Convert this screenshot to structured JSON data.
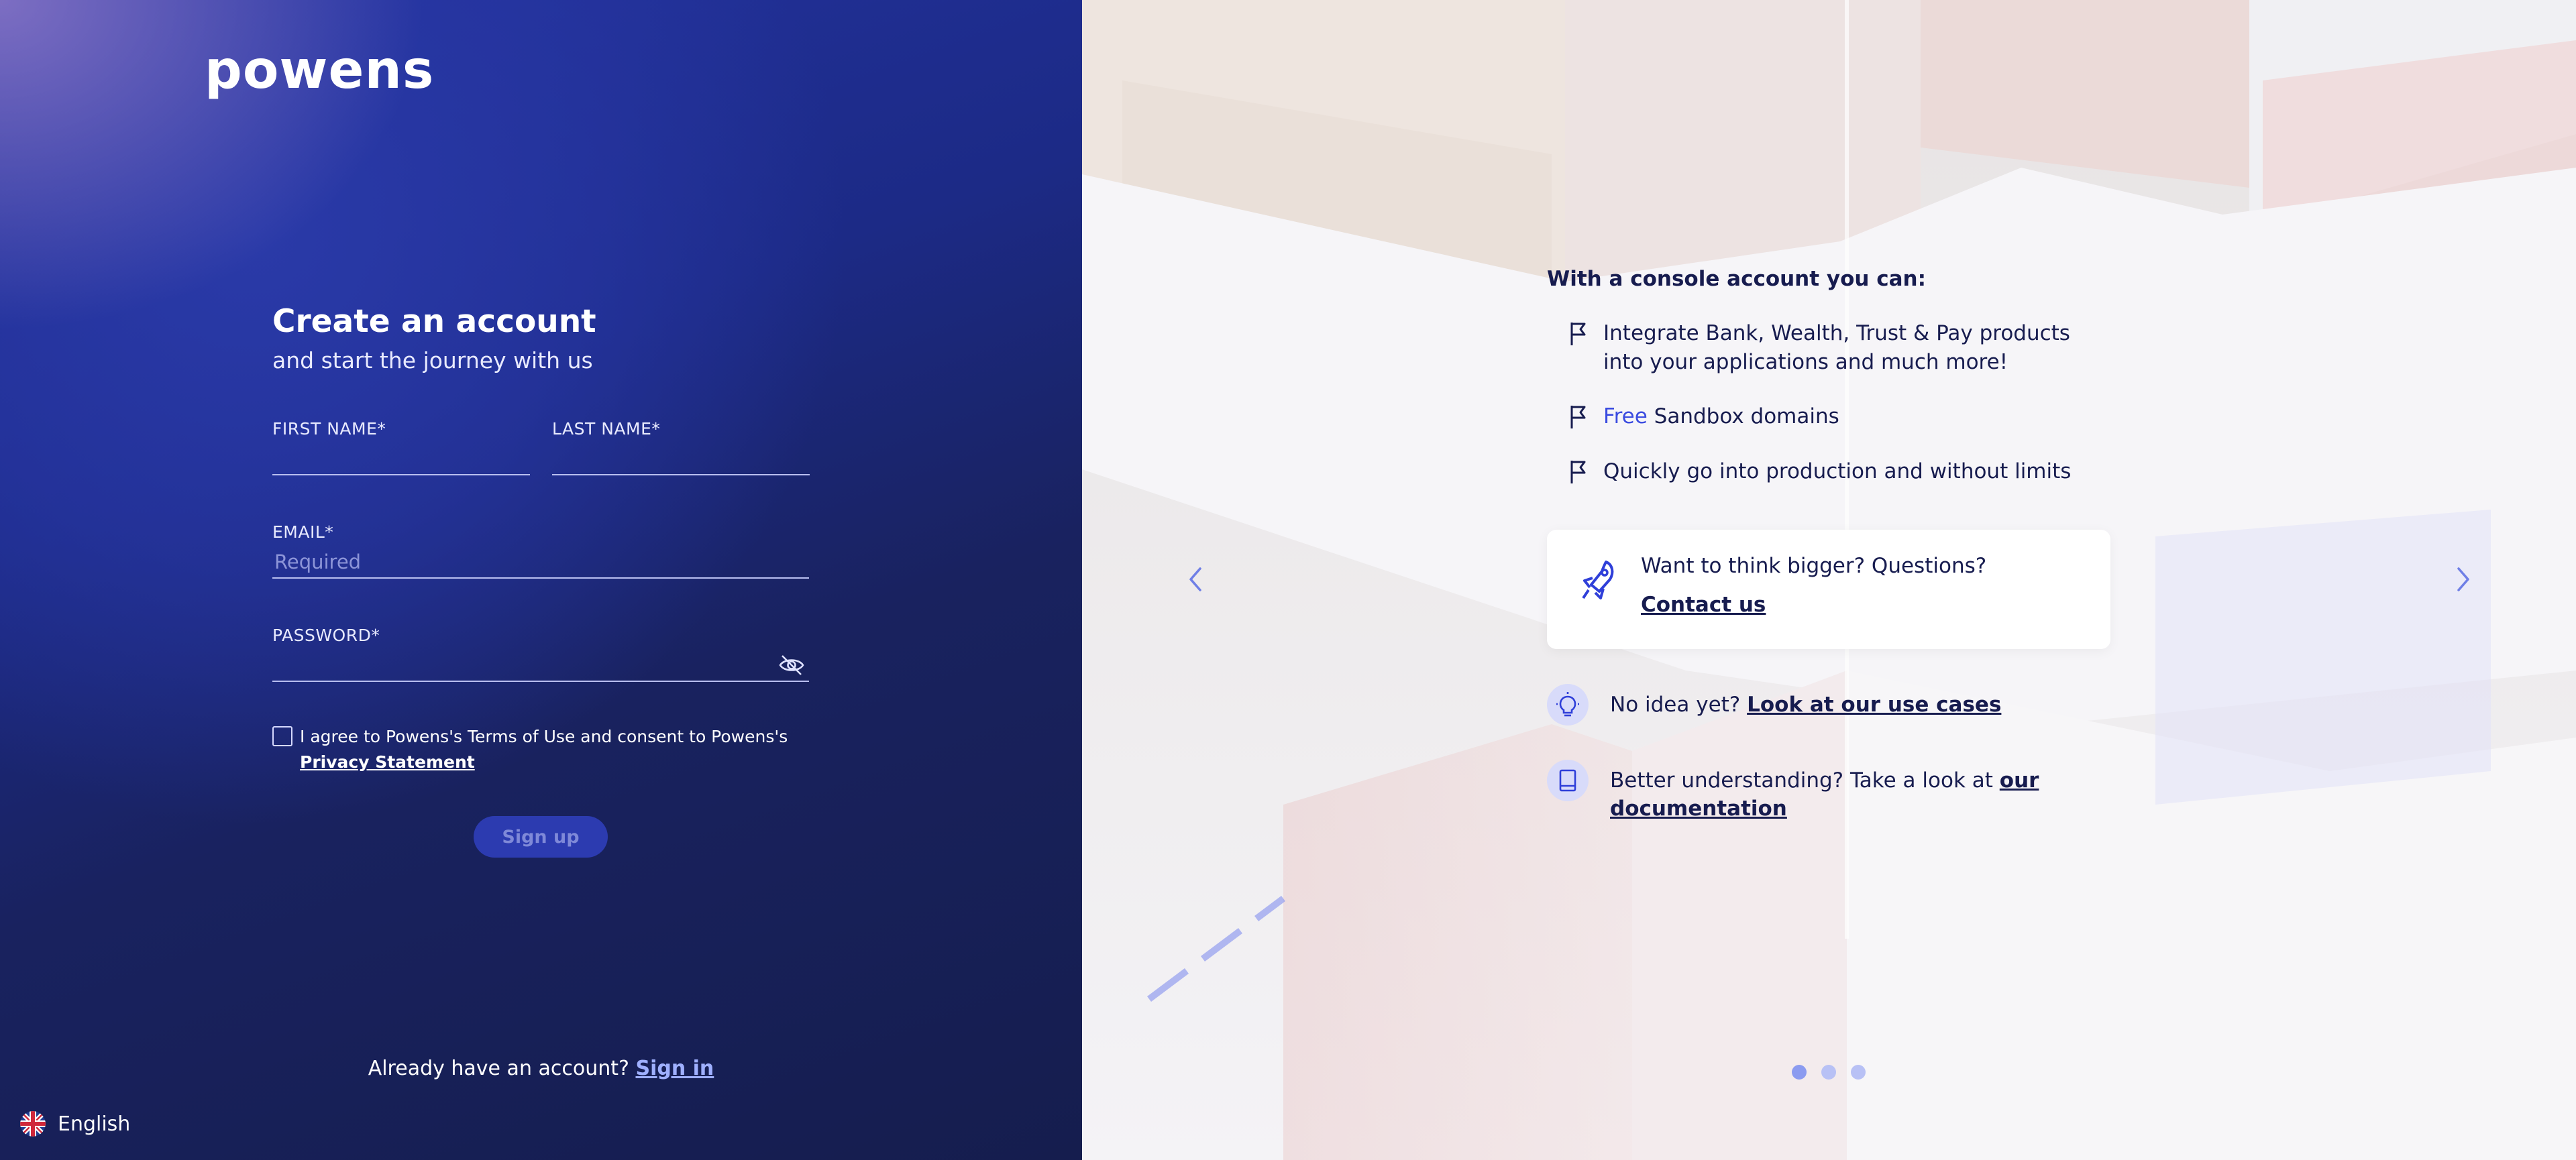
{
  "brand": {
    "logo_text": "powens"
  },
  "form": {
    "title": "Create an account",
    "subtitle": "and start the journey with us",
    "first_name_label": "FIRST NAME*",
    "first_name_value": "",
    "last_name_label": "LAST NAME*",
    "last_name_value": "",
    "email_label": "EMAIL*",
    "email_placeholder": "Required",
    "password_label": "PASSWORD*",
    "password_value": "",
    "terms_text": "I agree to Powens's Terms of Use and consent to Powens's",
    "privacy_link": "Privacy Statement",
    "signup_label": "Sign up",
    "signin_prompt": "Already have an account?",
    "signin_link": "Sign in"
  },
  "language": {
    "label": "English",
    "icon": "uk-flag-icon"
  },
  "promo": {
    "headline": "With a console account you can:",
    "features": [
      {
        "icon": "flag-icon",
        "text": "Integrate Bank, Wealth, Trust & Pay products into your applications and much more!"
      },
      {
        "icon": "flag-icon",
        "accent": "Free",
        "text": " Sandbox domains"
      },
      {
        "icon": "flag-icon",
        "text": "Quickly go into production and without limits"
      }
    ],
    "card": {
      "icon": "rocket-icon",
      "question": "Want to think bigger? Questions?",
      "link": "Contact us"
    },
    "tips": [
      {
        "icon": "lightbulb-icon",
        "text": "No idea yet? ",
        "link": "Look at our use cases"
      },
      {
        "icon": "book-icon",
        "text": "Better understanding? Take a look at ",
        "link": "our documentation"
      }
    ],
    "carousel": {
      "slides": 3,
      "active_index": 0
    }
  },
  "colors": {
    "left_panel_bg": "#1c2a86",
    "text_dark": "#171c4f",
    "accent_blue": "#3a4be0",
    "signup_button_bg": "#2c3bb0"
  }
}
